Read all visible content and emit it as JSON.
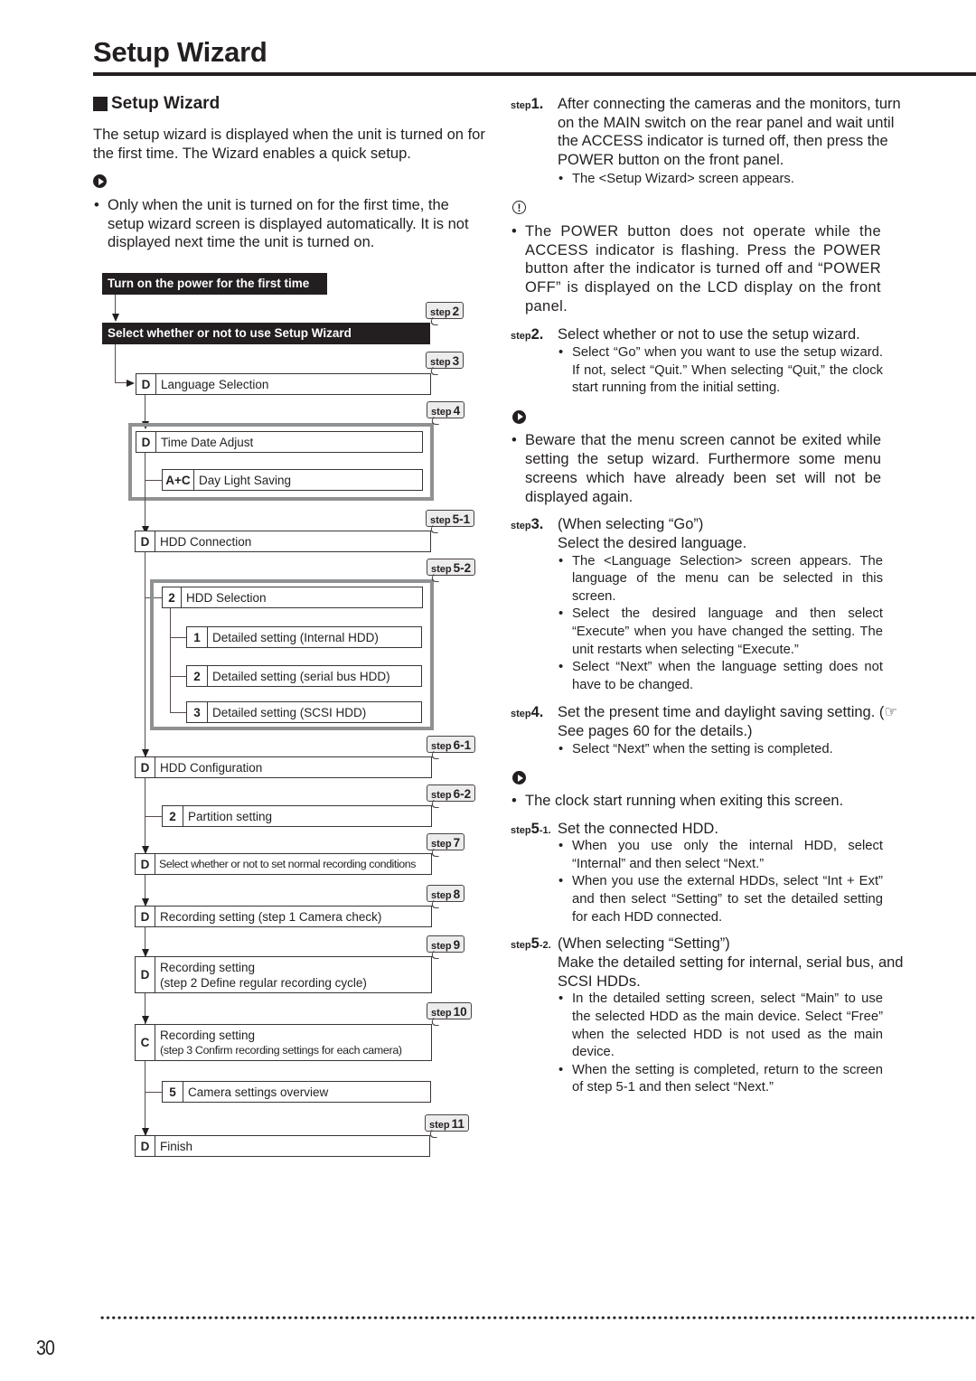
{
  "page": {
    "title": "Setup Wizard",
    "page_number": "30"
  },
  "left": {
    "section_heading": "Setup Wizard",
    "intro": "The setup wizard is displayed when the unit is turned on for the first time. The Wizard enables a quick setup.",
    "note_icon": "note-arrow-icon",
    "note_bullet": "Only when the unit is turned on for the first time, the setup wizard screen is displayed automatically. It is not displayed next time the unit is turned on."
  },
  "flowchart": {
    "start": "Turn on the power for the first time",
    "select_wizard": "Select whether or not to use Setup Wizard",
    "nodes": [
      {
        "tag": "D",
        "label": "Language Selection"
      },
      {
        "tag": "D",
        "label": "Time Date Adjust"
      },
      {
        "tag": "A+C",
        "label": "Day Light Saving"
      },
      {
        "tag": "D",
        "label": "HDD Connection"
      },
      {
        "tag": "2",
        "label": "HDD Selection"
      },
      {
        "tag": "1",
        "label": "Detailed setting (Internal HDD)"
      },
      {
        "tag": "2",
        "label": "Detailed setting (serial bus HDD)"
      },
      {
        "tag": "3",
        "label": "Detailed setting (SCSI HDD)"
      },
      {
        "tag": "D",
        "label": "HDD Configuration"
      },
      {
        "tag": "2",
        "label": "Partition setting"
      },
      {
        "tag": "D",
        "label": "Select whether or not to set normal recording conditions"
      },
      {
        "tag": "D",
        "label": "Recording setting (step 1 Camera check)"
      },
      {
        "tag": "D",
        "label": "Recording setting",
        "label2": "(step 2 Define regular recording cycle)"
      },
      {
        "tag": "C",
        "label": "Recording setting",
        "label2": "(step 3 Confirm recording settings for each camera)"
      },
      {
        "tag": "5",
        "label": "Camera settings overview"
      },
      {
        "tag": "D",
        "label": "Finish"
      }
    ],
    "step_tags": [
      {
        "prefix": "step",
        "num": "2"
      },
      {
        "prefix": "step",
        "num": "3"
      },
      {
        "prefix": "step",
        "num": "4"
      },
      {
        "prefix": "step",
        "num": "5-1"
      },
      {
        "prefix": "step",
        "num": "5-2"
      },
      {
        "prefix": "step",
        "num": "6-1"
      },
      {
        "prefix": "step",
        "num": "6-2"
      },
      {
        "prefix": "step",
        "num": "7"
      },
      {
        "prefix": "step",
        "num": "8"
      },
      {
        "prefix": "step",
        "num": "9"
      },
      {
        "prefix": "step",
        "num": "10"
      },
      {
        "prefix": "step",
        "num": "11"
      }
    ]
  },
  "right": {
    "step1": {
      "prefix": "step",
      "num": "1.",
      "text": "After connecting the cameras and the monitors, turn on the MAIN switch on the rear panel and wait until the ACCESS indicator is turned off, then press the POWER button on the front panel.",
      "bullets": [
        "The <Setup Wizard> screen appears."
      ]
    },
    "caution": {
      "icon": "caution-icon",
      "text": "The POWER button does not operate while the ACCESS indicator is flashing. Press the POWER button after the indicator is turned off and “POWER OFF” is displayed on the LCD display on the front panel."
    },
    "step2": {
      "prefix": "step",
      "num": "2.",
      "text": "Select whether or not to use the setup wizard.",
      "bullets": [
        "Select “Go” when you want to use the setup wizard. If not, select “Quit.” When selecting “Quit,” the clock start running from the initial setting."
      ]
    },
    "note2": {
      "icon": "note-arrow-icon",
      "text": "Beware that the menu screen cannot be exited while setting the setup wizard. Furthermore some menu screens which have already been set will not be displayed again."
    },
    "step3": {
      "prefix": "step",
      "num": "3.",
      "text1": "(When selecting “Go”)",
      "text2": "Select the desired language.",
      "bullets": [
        "The <Language Selection> screen appears. The language of the menu can be selected in this screen.",
        "Select the desired language and then select “Execute” when you have changed the setting. The unit restarts when selecting “Execute.”",
        "Select “Next” when the language setting does not have to be changed."
      ]
    },
    "step4": {
      "prefix": "step",
      "num": "4.",
      "text": "Set the present time and daylight saving setting. (☞ See pages 60 for the details.)",
      "bullets": [
        "Select “Next” when the setting is completed."
      ]
    },
    "note3": {
      "icon": "note-arrow-icon",
      "text": "The clock start running when exiting this screen."
    },
    "step5_1": {
      "prefix": "step",
      "num": "5",
      "sub": "-1.",
      "text": "Set the connected HDD.",
      "bullets": [
        "When you use only the internal HDD, select “Internal” and then select “Next.”",
        "When you use the external HDDs, select “Int + Ext” and then select “Setting” to set the detailed setting for each HDD connected."
      ]
    },
    "step5_2": {
      "prefix": "step",
      "num": "5",
      "sub": "-2.",
      "text1": "(When selecting “Setting”)",
      "text2": "Make the detailed setting for internal, serial bus, and SCSI HDDs.",
      "bullets": [
        "In the detailed setting screen, select “Main” to use the selected HDD as the main device. Select “Free” when the selected HDD is not used as the main device.",
        "When the setting is completed, return to the screen of step 5-1 and then select “Next.”"
      ]
    }
  }
}
